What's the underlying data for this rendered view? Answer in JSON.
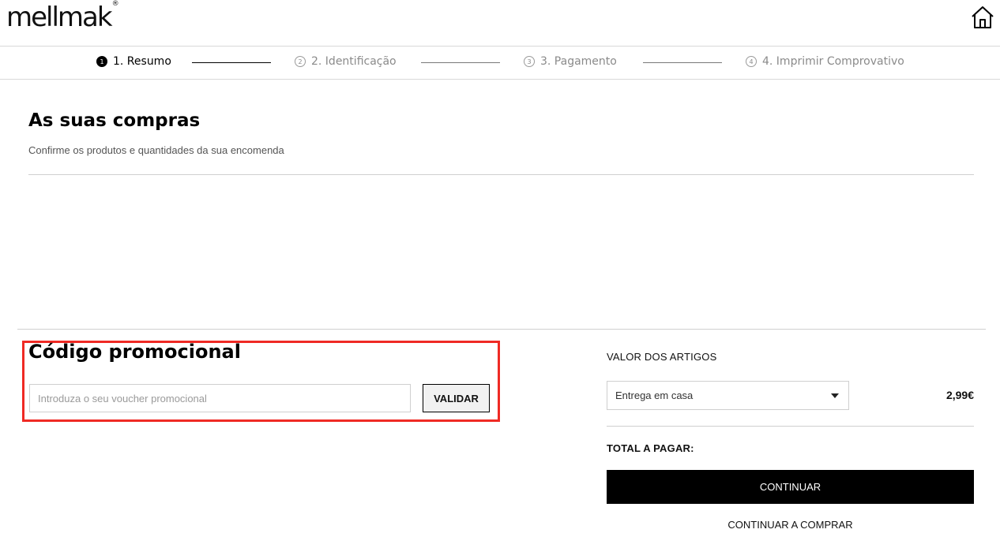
{
  "header": {
    "logo_text": "mellmak",
    "logo_mark": "®",
    "home_icon": "home-icon"
  },
  "steps": [
    {
      "number": "1",
      "label": "1. Resumo",
      "active": true
    },
    {
      "number": "2",
      "label": "2. Identificação",
      "active": false
    },
    {
      "number": "3",
      "label": "3. Pagamento",
      "active": false
    },
    {
      "number": "4",
      "label": "4. Imprimir Comprovativo",
      "active": false
    }
  ],
  "cart": {
    "title": "As suas compras",
    "subtitle": "Confirme os produtos e quantidades da sua encomenda"
  },
  "promo": {
    "title": "Código promocional",
    "placeholder": "Introduza o seu voucher promocional",
    "validate_label": "VALIDAR",
    "highlight_color": "#ef2a24"
  },
  "summary": {
    "items_label": "VALOR DOS ARTIGOS",
    "delivery_option": "Entrega em casa",
    "delivery_price": "2,99€",
    "total_label": "TOTAL A PAGAR:",
    "continue_label": "CONTINUAR",
    "continue_shopping_label": "CONTINUAR A COMPRAR"
  },
  "colors": {
    "primary": "#000000",
    "muted": "#8a8a8a"
  }
}
